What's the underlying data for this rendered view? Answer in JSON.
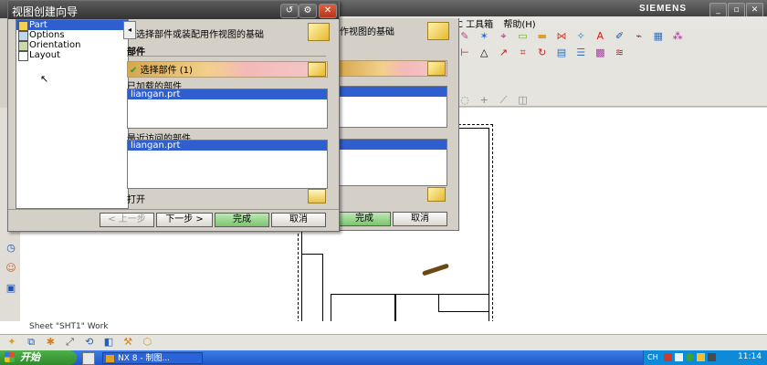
{
  "nx_window": {
    "brand": "SIEMENS",
    "menu_items": [
      "C 工具箱",
      "帮助(H)"
    ]
  },
  "dialog": {
    "title": "视图创建向导",
    "tree_items": [
      {
        "label": "Part",
        "selected": true
      },
      {
        "label": "Options",
        "selected": false
      },
      {
        "label": "Orientation",
        "selected": false
      },
      {
        "label": "Layout",
        "selected": false
      }
    ],
    "header_text": "选择部件或装配用作视图的基础",
    "group_label": "部件",
    "select_part_label": "选择部件 (1)",
    "loaded_label": "已加载的部件",
    "loaded_items": [
      "liangan.prt"
    ],
    "recent_label": "最近访问的部件",
    "recent_items": [
      "liangan.prt"
    ],
    "open_label": "打开",
    "buttons": {
      "back": "< 上一步",
      "next": "下一步 >",
      "finish": "完成",
      "cancel": "取消"
    }
  },
  "ghost_dialog": {
    "header_text": "作视图的基础",
    "finish": "完成",
    "cancel": "取消"
  },
  "status": {
    "text": "Sheet \"SHT1\" Work"
  },
  "taskbar": {
    "start_label": "开始",
    "task_item": "NX 8 - 制图...",
    "clock": "11:14",
    "lang": "CH"
  },
  "colors": {
    "selection_blue": "#2f5fce",
    "finish_green": "#7cc46e",
    "taskbar_blue": "#1f56c9"
  }
}
